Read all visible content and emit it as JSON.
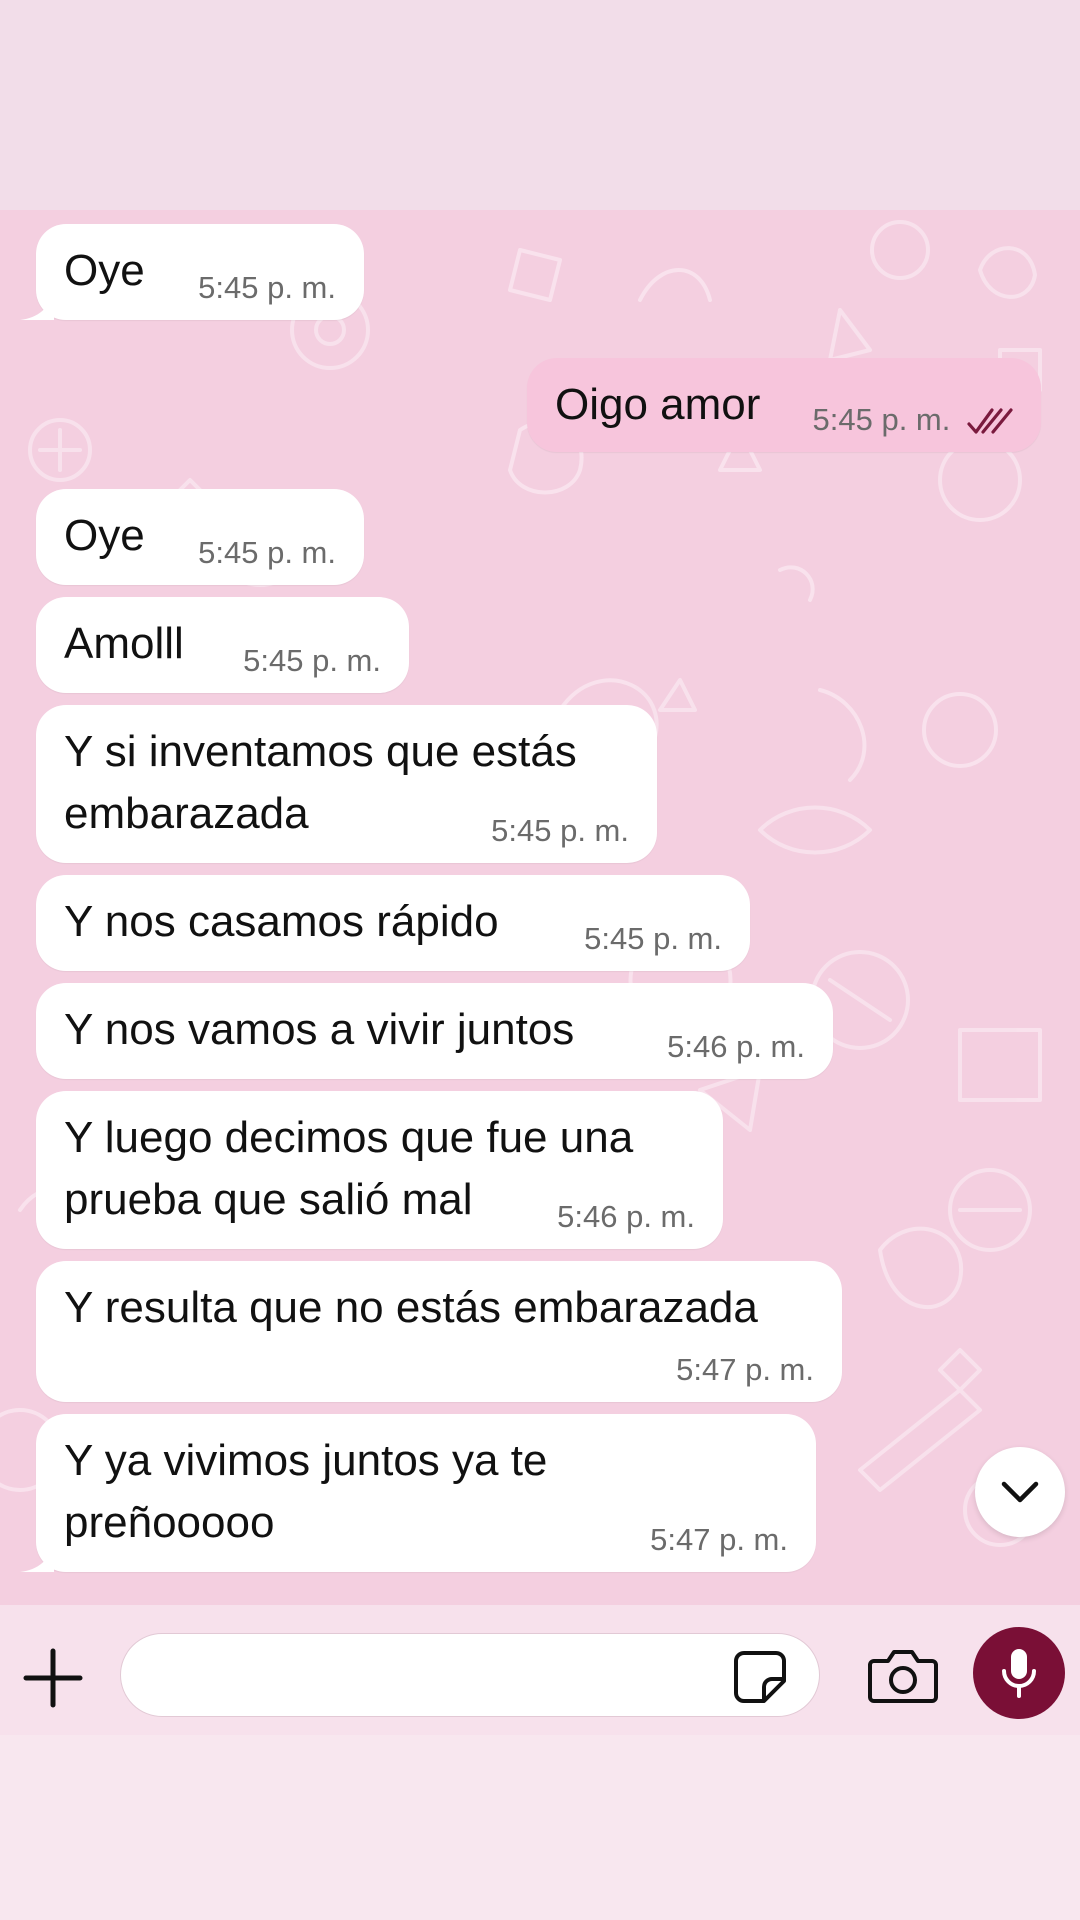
{
  "theme": {
    "chat_background": "#f4cfe0",
    "incoming_bubble": "#ffffff",
    "outgoing_bubble": "#f7c5dc",
    "accent": "#7a0f36",
    "read_ticks_color": "#7a1a3e"
  },
  "messages": [
    {
      "direction": "in",
      "text": "Oye",
      "time": "5:45 p. m."
    },
    {
      "direction": "out",
      "text": "Oigo amor",
      "time": "5:45 p. m.",
      "status": "read"
    },
    {
      "direction": "in",
      "text": "Oye",
      "time": "5:45 p. m."
    },
    {
      "direction": "in",
      "text": "Amolll",
      "time": "5:45 p. m."
    },
    {
      "direction": "in",
      "text": "Y si inventamos que estás\nembarazada",
      "time": "5:45 p. m."
    },
    {
      "direction": "in",
      "text": "Y nos casamos rápido",
      "time": "5:45 p. m."
    },
    {
      "direction": "in",
      "text": "Y nos vamos a vivir juntos",
      "time": "5:46 p. m."
    },
    {
      "direction": "in",
      "text": "Y luego decimos que fue una\nprueba que salió mal",
      "time": "5:46 p. m."
    },
    {
      "direction": "in",
      "text": "Y resulta que no estás embarazada",
      "time": "5:47 p. m."
    },
    {
      "direction": "in",
      "text": "Y ya vivimos juntos ya te\npreñooooo",
      "time": "5:47 p. m."
    }
  ],
  "composer": {
    "value": "",
    "placeholder": "",
    "icons": {
      "attach": "plus-icon",
      "sticker": "sticker-icon",
      "camera": "camera-icon",
      "voice": "microphone-icon",
      "scroll": "chevron-down-icon"
    }
  }
}
